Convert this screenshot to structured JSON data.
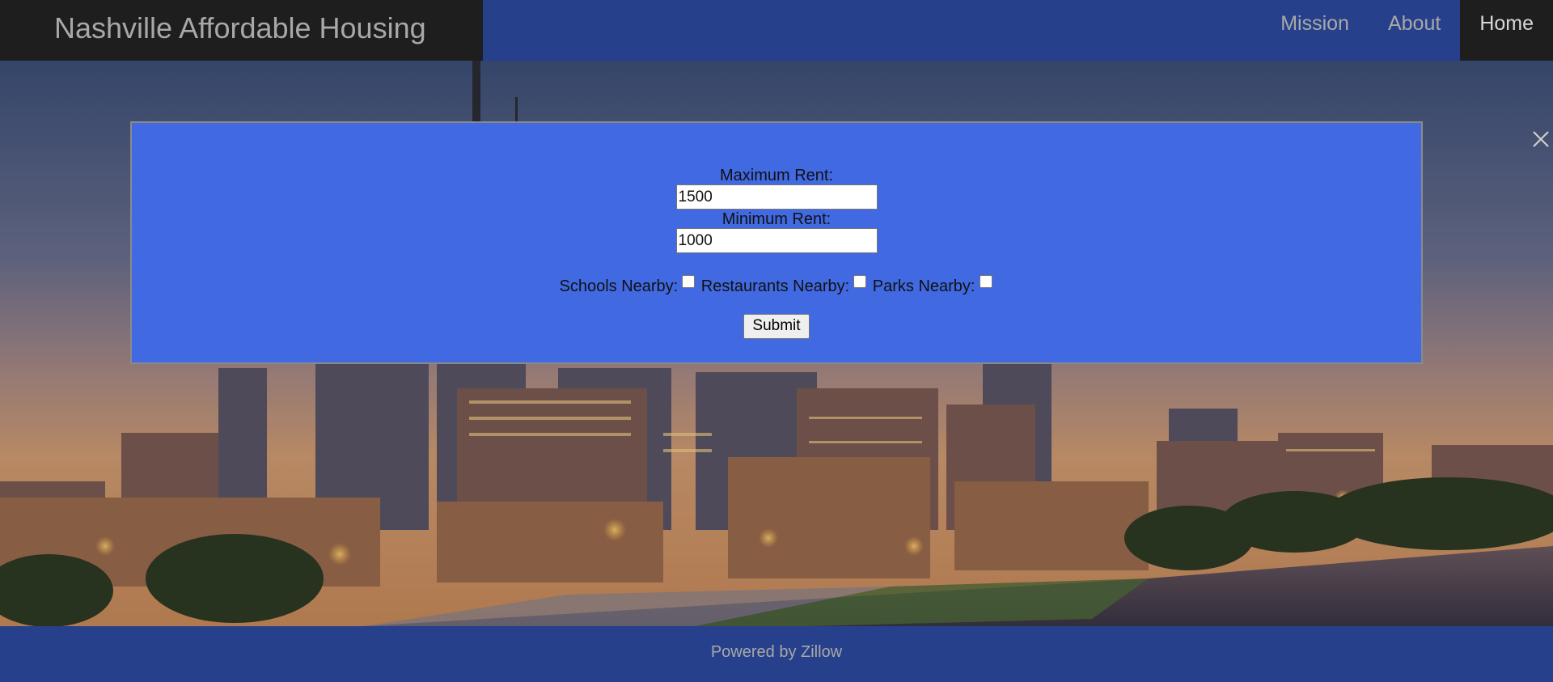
{
  "header": {
    "brand_title": "Nashville Affordable Housing",
    "nav": {
      "mission": "Mission",
      "about": "About",
      "home": "Home"
    },
    "active_nav": "Home"
  },
  "hero": {
    "image": "nashville-skyline-at-dusk"
  },
  "modal": {
    "max_rent": {
      "label": "Maximum Rent:",
      "value": "1500"
    },
    "min_rent": {
      "label": "Minimum Rent:",
      "value": "1000"
    },
    "checkboxes": [
      {
        "label": "Schools Nearby:",
        "checked": false
      },
      {
        "label": "Restaurants Nearby:",
        "checked": false
      },
      {
        "label": "Parks Nearby:",
        "checked": false
      }
    ],
    "submit_label": "Submit",
    "close_icon": "close-icon"
  },
  "footer": {
    "text": "Powered by Zillow"
  },
  "colors": {
    "nav_bar": "#27408b",
    "brand_bg": "#1e1e1e",
    "modal_bg": "#4169e1",
    "footer_bg": "#27408b"
  }
}
